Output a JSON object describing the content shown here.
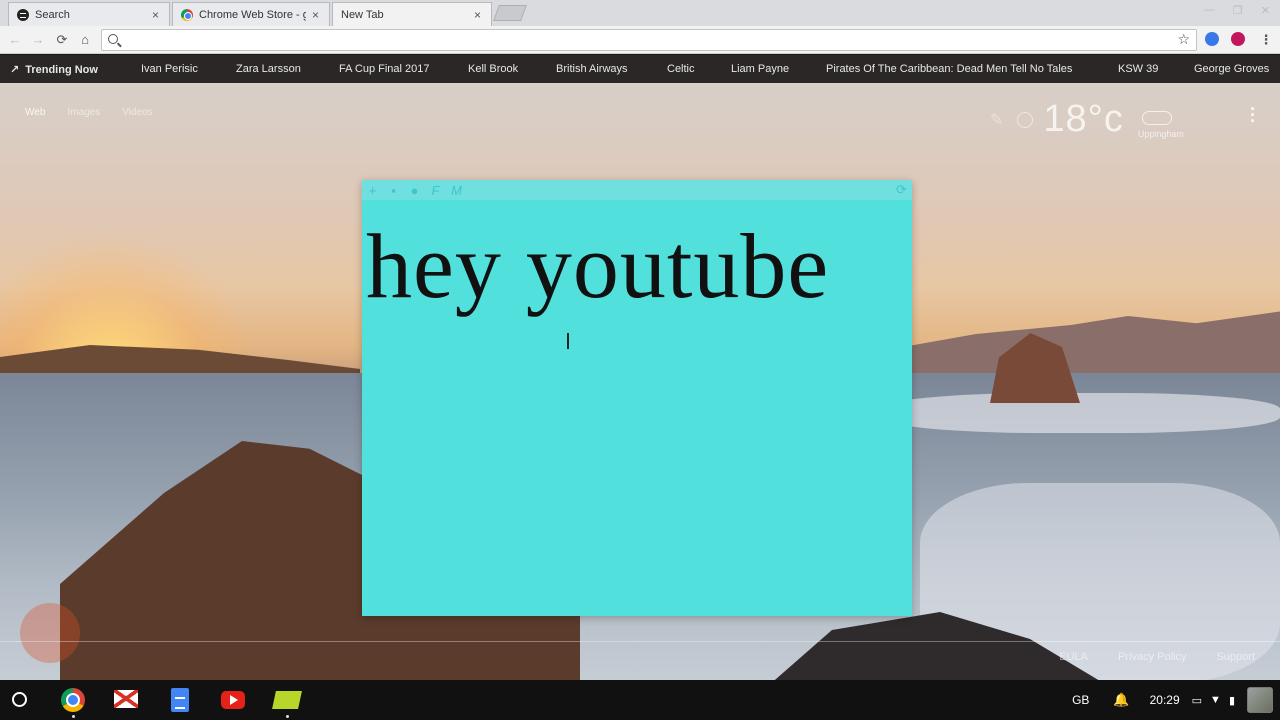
{
  "browser": {
    "tabs": [
      {
        "title": "Search",
        "icon": "spotify-icon",
        "close": "×"
      },
      {
        "title": "Chrome Web Store - goo",
        "icon": "chrome-web-store-icon",
        "close": "×"
      },
      {
        "title": "New Tab",
        "close": "×"
      }
    ],
    "window_controls": {
      "minimize": "—",
      "maximize": "❐",
      "close": "✕"
    },
    "toolbar": {
      "back": "←",
      "forward": "→",
      "reload": "⟳",
      "home": "⌂",
      "star": "☆",
      "menu": "⋮"
    },
    "omnibox": {
      "value": "",
      "placeholder": ""
    }
  },
  "trending": {
    "heading": "Trending Now",
    "items": [
      "Ivan Perisic",
      "Zara Larsson",
      "FA Cup Final 2017",
      "Kell Brook",
      "British Airways",
      "Celtic",
      "Liam Payne",
      "Pirates Of The Caribbean: Dead Men Tell No Tales",
      "KSW 39",
      "George Groves"
    ]
  },
  "newtab": {
    "nav": [
      "Web",
      "Images",
      "Videos"
    ],
    "weather": {
      "temp": "18°c",
      "city": "Uppingham"
    },
    "footer": [
      "EULA",
      "Privacy Policy",
      "Support"
    ]
  },
  "note": {
    "text": "hey youtube",
    "tools": [
      "+",
      "▪",
      "●",
      "F",
      "M"
    ],
    "refresh": "⟳"
  },
  "shelf": {
    "apps": [
      "chrome",
      "gmail",
      "docs",
      "youtube",
      "notes"
    ],
    "tray": {
      "lang": "GB",
      "time": "20:29"
    }
  },
  "colors": {
    "note_bg": "#52e0dc",
    "trending_bar": "#2d2828"
  }
}
